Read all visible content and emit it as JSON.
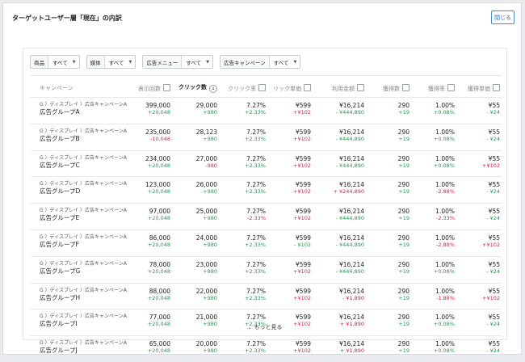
{
  "header": {
    "title": "ターゲットユーザー層「現在」の内訳",
    "close_label": "閉じる"
  },
  "filters": [
    {
      "label": "商品",
      "value": "すべて"
    },
    {
      "label": "媒体",
      "value": "すべて"
    },
    {
      "label": "広告メニュー",
      "value": "すべて"
    },
    {
      "label": "広告キャンペーン",
      "value": "すべて"
    }
  ],
  "columns": [
    "キャンペーン",
    "表示回数",
    "クリック数",
    "クリック率",
    "リック単価",
    "利用金額",
    "獲得数",
    "獲得率",
    "獲得単価"
  ],
  "rows": [
    {
      "path": "G 〉ディスプレイ 〉広告キャンペーンA 〉",
      "group": "広告グループA",
      "impr": "399,000",
      "impr_d": "+20,048",
      "impr_s": "pos",
      "clicks": "29,000",
      "clicks_d": "+980",
      "clicks_s": "pos",
      "ctr": "7.27%",
      "ctr_d": "+2.33%",
      "ctr_s": "pos",
      "cpc": "¥599",
      "cpc_d": "+¥102",
      "cpc_s": "neg",
      "cost": "¥16,214",
      "cost_d": "- ¥444,890",
      "cost_s": "pos",
      "conv": "290",
      "conv_d": "+19",
      "conv_s": "pos",
      "cvr": "1.00%",
      "cvr_d": "+0.08%",
      "cvr_s": "pos",
      "cpa": "¥55",
      "cpa_d": "- ¥24",
      "cpa_s": "pos"
    },
    {
      "path": "G 〉ディスプレイ 〉広告キャンペーンA 〉",
      "group": "広告グループB",
      "impr": "235,000",
      "impr_d": "-10,048",
      "impr_s": "neg",
      "clicks": "28,123",
      "clicks_d": "+980",
      "clicks_s": "pos",
      "ctr": "7.27%",
      "ctr_d": "+2.33%",
      "ctr_s": "pos",
      "cpc": "¥599",
      "cpc_d": "+¥102",
      "cpc_s": "neg",
      "cost": "¥16,214",
      "cost_d": "- ¥444,890",
      "cost_s": "pos",
      "conv": "290",
      "conv_d": "+19",
      "conv_s": "pos",
      "cvr": "1.00%",
      "cvr_d": "+0.08%",
      "cvr_s": "pos",
      "cpa": "¥55",
      "cpa_d": "- ¥24",
      "cpa_s": "pos"
    },
    {
      "path": "G 〉ディスプレイ 〉広告キャンペーンA 〉",
      "group": "広告グループC",
      "impr": "234,000",
      "impr_d": "+20,048",
      "impr_s": "pos",
      "clicks": "27,000",
      "clicks_d": "-980",
      "clicks_s": "neg",
      "ctr": "7.27%",
      "ctr_d": "+2.33%",
      "ctr_s": "pos",
      "cpc": "¥599",
      "cpc_d": "+¥102",
      "cpc_s": "neg",
      "cost": "¥16,214",
      "cost_d": "- ¥444,890",
      "cost_s": "pos",
      "conv": "290",
      "conv_d": "+19",
      "conv_s": "pos",
      "cvr": "1.00%",
      "cvr_d": "+0.08%",
      "cvr_s": "pos",
      "cpa": "¥55",
      "cpa_d": "+¥102",
      "cpa_s": "neg"
    },
    {
      "path": "G 〉ディスプレイ 〉広告キャンペーンA 〉",
      "group": "広告グループD",
      "impr": "123,000",
      "impr_d": "+20,048",
      "impr_s": "pos",
      "clicks": "26,000",
      "clicks_d": "+980",
      "clicks_s": "pos",
      "ctr": "7.27%",
      "ctr_d": "+2.33%",
      "ctr_s": "pos",
      "cpc": "¥599",
      "cpc_d": "+¥102",
      "cpc_s": "neg",
      "cost": "¥16,214",
      "cost_d": "+ ¥244,890",
      "cost_s": "neg",
      "conv": "290",
      "conv_d": "+19",
      "conv_s": "pos",
      "cvr": "1.00%",
      "cvr_d": "-2.88%",
      "cvr_s": "neg",
      "cpa": "¥55",
      "cpa_d": "- ¥24",
      "cpa_s": "pos"
    },
    {
      "path": "G 〉ディスプレイ 〉広告キャンペーンA 〉",
      "group": "広告グループE",
      "impr": "97,000",
      "impr_d": "+20,048",
      "impr_s": "pos",
      "clicks": "25,000",
      "clicks_d": "+980",
      "clicks_s": "pos",
      "ctr": "7.27%",
      "ctr_d": "-2.33%",
      "ctr_s": "neg",
      "cpc": "¥599",
      "cpc_d": "+¥102",
      "cpc_s": "neg",
      "cost": "¥16,214",
      "cost_d": "- ¥444,890",
      "cost_s": "pos",
      "conv": "290",
      "conv_d": "+19",
      "conv_s": "pos",
      "cvr": "1.00%",
      "cvr_d": "-2.33%",
      "cvr_s": "neg",
      "cpa": "¥55",
      "cpa_d": "- ¥24",
      "cpa_s": "pos"
    },
    {
      "path": "G 〉ディスプレイ 〉広告キャンペーンA 〉",
      "group": "広告グループF",
      "impr": "86,000",
      "impr_d": "+20,048",
      "impr_s": "pos",
      "clicks": "24,000",
      "clicks_d": "+980",
      "clicks_s": "pos",
      "ctr": "7.27%",
      "ctr_d": "+2.33%",
      "ctr_s": "pos",
      "cpc": "¥599",
      "cpc_d": "- ¥102",
      "cpc_s": "pos",
      "cost": "¥16,214",
      "cost_d": "- ¥444,890",
      "cost_s": "pos",
      "conv": "290",
      "conv_d": "+19",
      "conv_s": "pos",
      "cvr": "1.00%",
      "cvr_d": "-2.88%",
      "cvr_s": "neg",
      "cpa": "¥55",
      "cpa_d": "+¥102",
      "cpa_s": "neg"
    },
    {
      "path": "G 〉ディスプレイ 〉広告キャンペーンA 〉",
      "group": "広告グループG",
      "impr": "78,000",
      "impr_d": "+20,048",
      "impr_s": "pos",
      "clicks": "23,000",
      "clicks_d": "+980",
      "clicks_s": "pos",
      "ctr": "7.27%",
      "ctr_d": "+2.33%",
      "ctr_s": "pos",
      "cpc": "¥599",
      "cpc_d": "+¥102",
      "cpc_s": "neg",
      "cost": "¥16,214",
      "cost_d": "- ¥444,890",
      "cost_s": "pos",
      "conv": "290",
      "conv_d": "+19",
      "conv_s": "pos",
      "cvr": "1.00%",
      "cvr_d": "+0.08%",
      "cvr_s": "pos",
      "cpa": "¥55",
      "cpa_d": "- ¥24",
      "cpa_s": "pos"
    },
    {
      "path": "G 〉ディスプレイ 〉広告キャンペーンA 〉",
      "group": "広告グループH",
      "impr": "88,000",
      "impr_d": "+20,048",
      "impr_s": "pos",
      "clicks": "22,000",
      "clicks_d": "+980",
      "clicks_s": "pos",
      "ctr": "7.27%",
      "ctr_d": "+2.33%",
      "ctr_s": "pos",
      "cpc": "¥599",
      "cpc_d": "+¥102",
      "cpc_s": "neg",
      "cost": "¥16,214",
      "cost_d": "- ¥1,890",
      "cost_s": "neg",
      "conv": "290",
      "conv_d": "+19",
      "conv_s": "pos",
      "cvr": "1.00%",
      "cvr_d": "-1.88%",
      "cvr_s": "neg",
      "cpa": "¥55",
      "cpa_d": "+¥102",
      "cpa_s": "neg"
    },
    {
      "path": "G 〉ディスプレイ 〉広告キャンペーンA 〉",
      "group": "広告グループI",
      "impr": "77,000",
      "impr_d": "+20,048",
      "impr_s": "pos",
      "clicks": "21,000",
      "clicks_d": "+980",
      "clicks_s": "pos",
      "ctr": "7.27%",
      "ctr_d": "+2.33%",
      "ctr_s": "pos",
      "cpc": "¥599",
      "cpc_d": "+¥102",
      "cpc_s": "neg",
      "cost": "¥16,214",
      "cost_d": "+ ¥1,890",
      "cost_s": "neg",
      "conv": "290",
      "conv_d": "+19",
      "conv_s": "pos",
      "cvr": "1.00%",
      "cvr_d": "+0.08%",
      "cvr_s": "pos",
      "cpa": "¥55",
      "cpa_d": "- ¥24",
      "cpa_s": "pos"
    },
    {
      "path": "G 〉ディスプレイ 〉広告キャンペーンA 〉",
      "group": "広告グループJ",
      "impr": "65,000",
      "impr_d": "+20,048",
      "impr_s": "pos",
      "clicks": "20,000",
      "clicks_d": "+980",
      "clicks_s": "pos",
      "ctr": "7.27%",
      "ctr_d": "+2.33%",
      "ctr_s": "pos",
      "cpc": "¥599",
      "cpc_d": "+¥102",
      "cpc_s": "neg",
      "cost": "¥16,214",
      "cost_d": "+ ¥1,890",
      "cost_s": "neg",
      "conv": "290",
      "conv_d": "+19",
      "conv_s": "pos",
      "cvr": "1.00%",
      "cvr_d": "+0.08%",
      "cvr_s": "pos",
      "cpa": "¥55",
      "cpa_d": "- ¥24",
      "cpa_s": "pos"
    }
  ],
  "more_label": "もっと見る",
  "colors": {
    "positive": "#1a9e4a",
    "negative": "#e0233e",
    "accent": "#2a6fc5"
  }
}
